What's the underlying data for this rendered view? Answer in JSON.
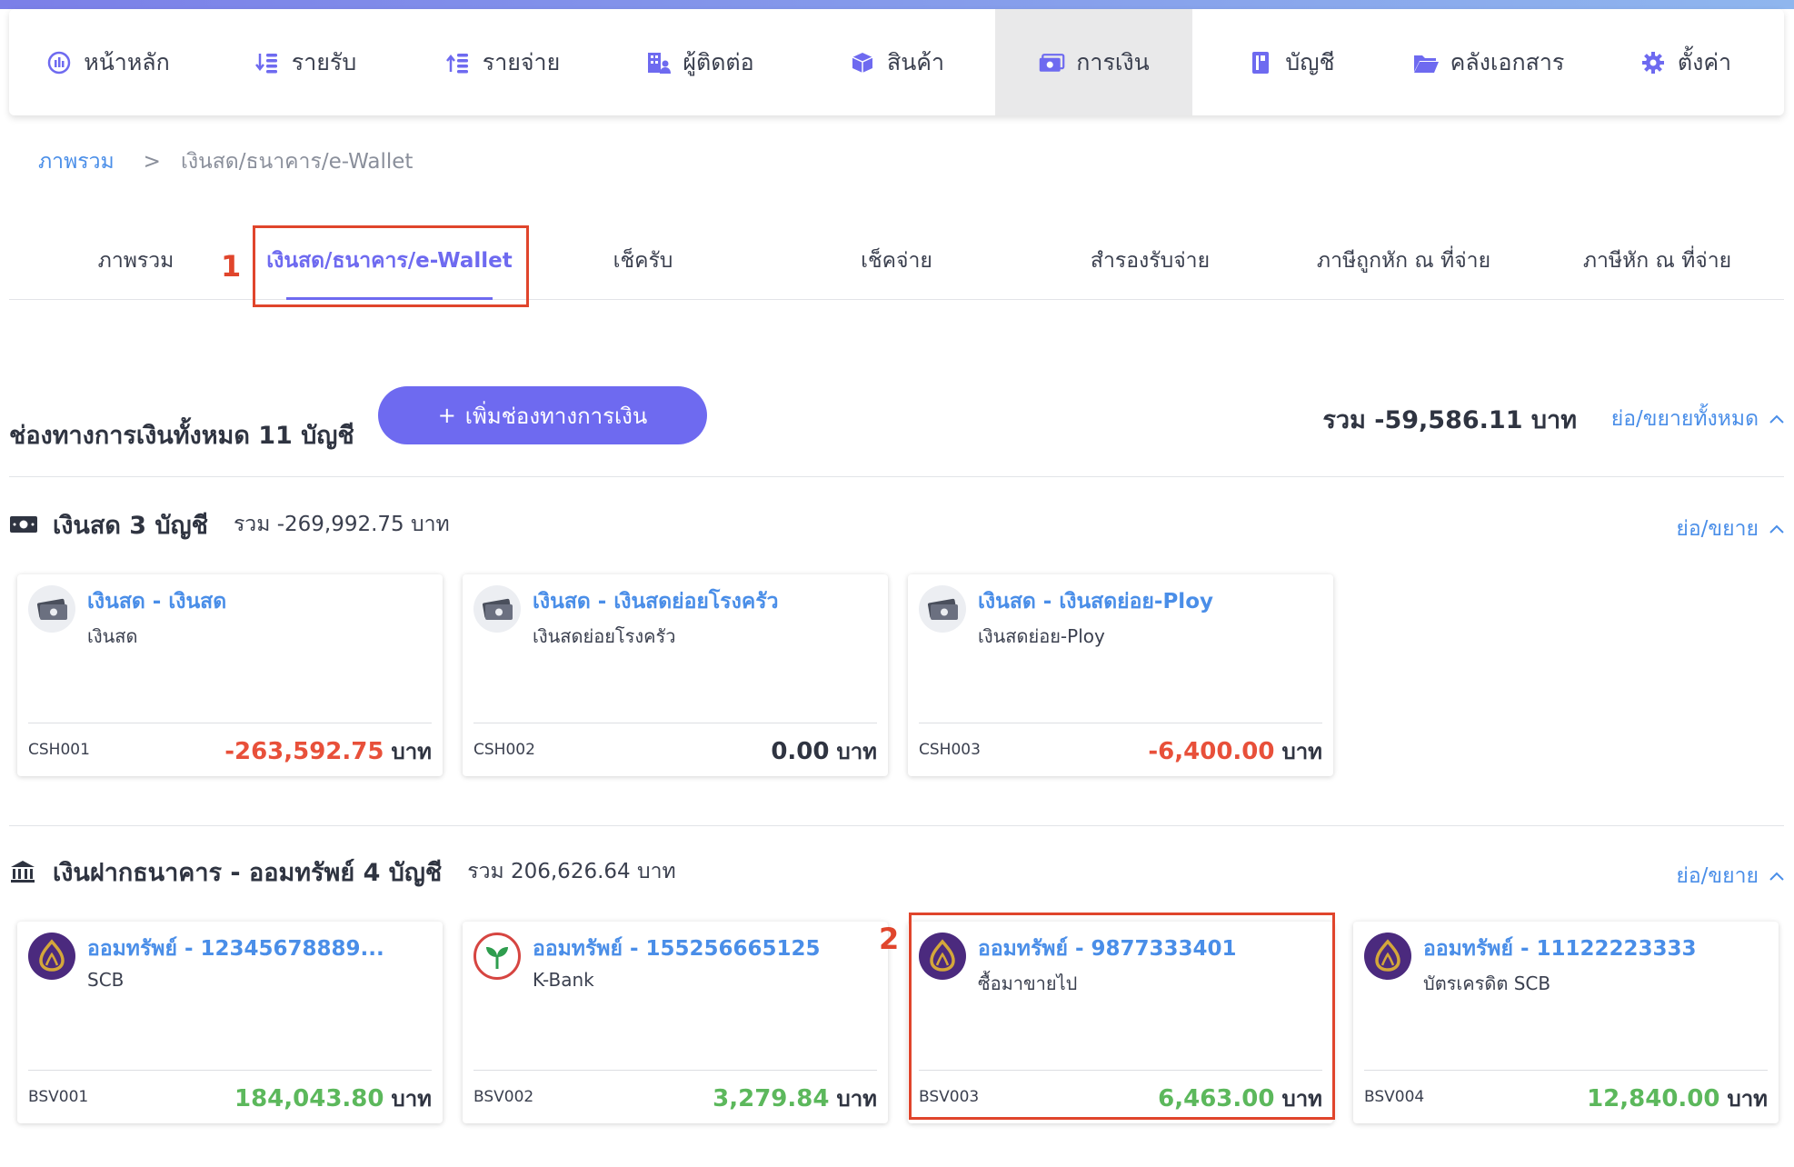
{
  "nav": {
    "items": [
      {
        "label": "หน้าหลัก",
        "icon": "dashboard-icon"
      },
      {
        "label": "รายรับ",
        "icon": "income-icon"
      },
      {
        "label": "รายจ่าย",
        "icon": "expense-icon"
      },
      {
        "label": "ผู้ติดต่อ",
        "icon": "contacts-icon"
      },
      {
        "label": "สินค้า",
        "icon": "box-icon"
      },
      {
        "label": "การเงิน",
        "icon": "money-icon",
        "active": true
      },
      {
        "label": "บัญชี",
        "icon": "ledger-icon"
      },
      {
        "label": "คลังเอกสาร",
        "icon": "folder-icon"
      },
      {
        "label": "ตั้งค่า",
        "icon": "gear-icon"
      }
    ]
  },
  "breadcrumb": {
    "root": "ภาพรวม",
    "separator": ">",
    "current": "เงินสด/ธนาคาร/e-Wallet"
  },
  "tabs": [
    {
      "label": "ภาพรวม"
    },
    {
      "label": "เงินสด/ธนาคาร/e-Wallet",
      "active": true
    },
    {
      "label": "เช็ครับ"
    },
    {
      "label": "เช็คจ่าย"
    },
    {
      "label": "สำรองรับจ่าย"
    },
    {
      "label": "ภาษีถูกหัก ณ ที่จ่าย"
    },
    {
      "label": "ภาษีหัก ณ ที่จ่าย"
    }
  ],
  "annotations": {
    "one": "1",
    "two": "2"
  },
  "summary": {
    "title": "ช่องทางการเงินทั้งหมด 11 บัญชี",
    "add_button": "เพิ่มช่องทางการเงิน",
    "add_icon": "+",
    "total": "รวม -59,586.11 บาท",
    "toggle": "ย่อ/ขยายทั้งหมด"
  },
  "cash_section": {
    "title": "เงินสด 3 บัญชี",
    "sum": "รวม -269,992.75 บาท",
    "toggle": "ย่อ/ขยาย",
    "cards": [
      {
        "title": "เงินสด - เงินสด",
        "sub": "เงินสด",
        "code": "CSH001",
        "amount": "-263,592.75",
        "unit": "บาท"
      },
      {
        "title": "เงินสด - เงินสดย่อยโรงครัว",
        "sub": "เงินสดย่อยโรงครัว",
        "code": "CSH002",
        "amount": "0.00",
        "unit": "บาท"
      },
      {
        "title": "เงินสด - เงินสดย่อย-Ploy",
        "sub": "เงินสดย่อย-Ploy",
        "code": "CSH003",
        "amount": "-6,400.00",
        "unit": "บาท"
      }
    ]
  },
  "bank_section": {
    "title": "เงินฝากธนาคาร - ออมทรัพย์ 4 บัญชี",
    "sum": "รวม 206,626.64 บาท",
    "toggle": "ย่อ/ขยาย",
    "cards": [
      {
        "title": "ออมทรัพย์ - 12345678889...",
        "sub": "SCB",
        "code": "BSV001",
        "amount": "184,043.80",
        "unit": "บาท",
        "bank": "scb"
      },
      {
        "title": "ออมทรัพย์ - 155256665125",
        "sub": "K-Bank",
        "code": "BSV002",
        "amount": "3,279.84",
        "unit": "บาท",
        "bank": "kbank"
      },
      {
        "title": "ออมทรัพย์ - 9877333401",
        "sub": "ซื้อมาขายไป",
        "code": "BSV003",
        "amount": "6,463.00",
        "unit": "บาท",
        "bank": "scb"
      },
      {
        "title": "ออมทรัพย์ - 11122223333",
        "sub": "บัตรเครดิต SCB",
        "code": "BSV004",
        "amount": "12,840.00",
        "unit": "บาท",
        "bank": "scb"
      }
    ]
  },
  "colors": {
    "accent": "#6e6af0",
    "link": "#4a8ee8",
    "negative": "#e8503a",
    "positive": "#5cb85c",
    "highlight": "#e0452c"
  }
}
